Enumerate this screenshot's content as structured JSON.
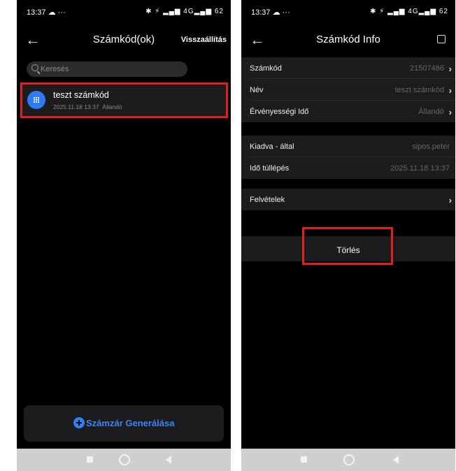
{
  "left": {
    "status": {
      "time": "13:37 ☁ ···",
      "icons": "✱ ⚡ ▂▄▆ 4G▂▄▆ 62"
    },
    "title": "Számkód(ok)",
    "reset": "Visszaállítás",
    "search_placeholder": "Keresés",
    "item": {
      "name": "teszt számkód",
      "date": "2025.11.18 13:37",
      "validity": "Állandó"
    },
    "generate_label": "Számzár Generálása"
  },
  "right": {
    "status": {
      "time": "13:37 ☁ ···",
      "icons": "✱ ⚡ ▂▄▆ 4G▂▄▆ 62"
    },
    "title": "Számkód Info",
    "group1": [
      {
        "key": "Számkód",
        "value": "21507486"
      },
      {
        "key": "Név",
        "value": "teszt számkód"
      },
      {
        "key": "Érvényességi Idő",
        "value": "Állandó"
      }
    ],
    "group2": [
      {
        "key": "Kiadva - által",
        "value": "sipos.peter"
      },
      {
        "key": "Idő túllépés",
        "value": "2025.11.18 13:37"
      }
    ],
    "group3": [
      {
        "key": "Felvételek"
      }
    ],
    "delete_label": "Törlés"
  },
  "colors": {
    "accent": "#2f80f2",
    "highlight": "#e3201c",
    "background": "#000000",
    "card": "#1c1c1e"
  }
}
